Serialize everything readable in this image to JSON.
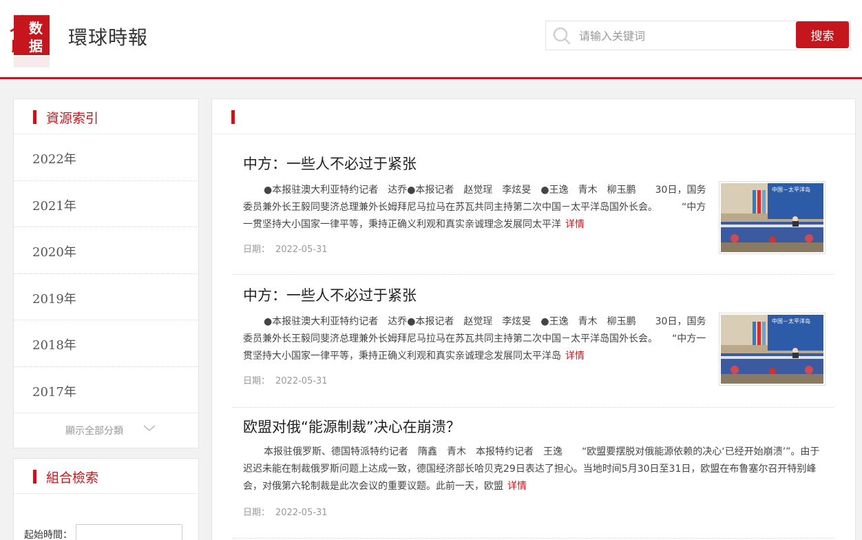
{
  "header": {
    "site_title": "環球時報",
    "logo_text": "人民数据",
    "search_placeholder": "请输入关键词",
    "search_button": "搜索"
  },
  "sidebar": {
    "resource_index_title": "資源索引",
    "years": [
      "2022年",
      "2021年",
      "2020年",
      "2019年",
      "2018年",
      "2017年"
    ],
    "show_all_label": "顯示全部分類",
    "combined_search_title": "組合檢索",
    "start_date_label": "起始時間："
  },
  "main": {
    "articles": [
      {
        "title": "中方：一些人不必过于紧张",
        "body": "●本报驻澳大利亚特约记者　达乔●本报记者　赵觉珵　李炫旻　●王逸　青木　柳玉鹏　　30日，国务委员兼外长王毅同斐济总理兼外长姆拜尼马拉马在苏瓦共同主持第二次中国－太平洋岛国外长会。　　　“中方一贯坚持大小国家一律平等，秉持正确义利观和真实亲诚理念发展同太平洋",
        "more": "详情",
        "date_label": "日期：",
        "date": "2022-05-31",
        "has_image": true
      },
      {
        "title": "中方：一些人不必过于紧张",
        "body": "●本报驻澳大利亚特约记者　达乔●本报记者　赵觉珵　李炫旻　●王逸　青木　柳玉鹏　　30日，国务委员兼外长王毅同斐济总理兼外长姆拜尼马拉马在苏瓦共同主持第二次中国－太平洋岛国外长会。　　“中方一贯坚持大小国家一律平等，秉持正确义利观和真实亲诚理念发展同太平洋岛",
        "more": "详情",
        "date_label": "日期：",
        "date": "2022-05-31",
        "has_image": true
      },
      {
        "title": "欧盟对俄“能源制裁”决心在崩溃？",
        "body": "本报驻俄罗斯、德国特派特约记者　隋鑫　青木　本报特约记者　王逸　　“欧盟要摆脱对俄能源依赖的决心‘已经开始崩溃’”。由于迟迟未能在制裁俄罗斯问题上达成一致，德国经济部长哈贝克29日表达了担心。当地时间5月30日至31日，欧盟在布鲁塞尔召开特别峰会，对俄第六轮制裁是此次会议的重要议题。此前一天，欧盟",
        "more": "详情",
        "date_label": "日期：",
        "date": "2022-05-31",
        "has_image": false
      }
    ]
  },
  "colors": {
    "accent": "#c4161c"
  }
}
